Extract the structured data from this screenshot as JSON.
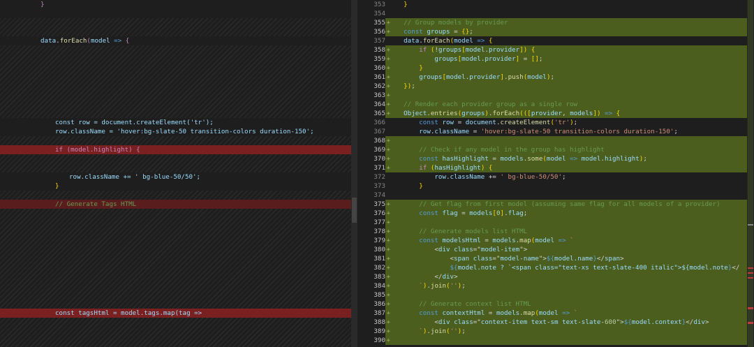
{
  "left": {
    "brace_close": "}",
    "foreach_line": [
      "data",
      ".",
      "forEach",
      "(",
      "model",
      " => ",
      "{"
    ],
    "row_create": "const row = document.createElement('tr');",
    "row_class": "row.className = 'hover:bg-slate-50 transition-colors duration-150';",
    "if_highlight": "if (model.highlight) {",
    "row_class_add": "row.className += ' bg-blue-50/50';",
    "close_brace": "}",
    "comment_tags": "// Generate Tags HTML",
    "tags_html": "const tagsHtml = model.tags.map(tag =>"
  },
  "right": {
    "lines": [
      {
        "n": "353",
        "plus": false,
        "text": "    }"
      },
      {
        "n": "354",
        "plus": false,
        "text": ""
      },
      {
        "n": "355",
        "plus": true,
        "text": "    // Group models by provider"
      },
      {
        "n": "356",
        "plus": true,
        "text": "    const groups = {};"
      },
      {
        "n": "357",
        "plus": false,
        "text": "    data.forEach(model => {"
      },
      {
        "n": "358",
        "plus": true,
        "text": "        if (!groups[model.provider]) {"
      },
      {
        "n": "359",
        "plus": true,
        "text": "            groups[model.provider] = [];"
      },
      {
        "n": "360",
        "plus": true,
        "text": "        }"
      },
      {
        "n": "361",
        "plus": true,
        "text": "        groups[model.provider].push(model);"
      },
      {
        "n": "362",
        "plus": true,
        "text": "    });"
      },
      {
        "n": "363",
        "plus": true,
        "text": ""
      },
      {
        "n": "364",
        "plus": true,
        "text": "    // Render each provider group as a single row"
      },
      {
        "n": "365",
        "plus": true,
        "text": "    Object.entries(groups).forEach(([provider, models]) => {"
      },
      {
        "n": "366",
        "plus": false,
        "text": "        const row = document.createElement('tr');"
      },
      {
        "n": "367",
        "plus": false,
        "text": "        row.className = 'hover:bg-slate-50 transition-colors duration-150';"
      },
      {
        "n": "368",
        "plus": true,
        "text": ""
      },
      {
        "n": "369",
        "plus": true,
        "text": "        // Check if any model in the group has highlight"
      },
      {
        "n": "370",
        "plus": true,
        "text": "        const hasHighlight = models.some(model => model.highlight);"
      },
      {
        "n": "371",
        "plus": true,
        "text": "        if (hasHighlight) {"
      },
      {
        "n": "372",
        "plus": false,
        "text": "            row.className += ' bg-blue-50/50';"
      },
      {
        "n": "373",
        "plus": false,
        "text": "        }"
      },
      {
        "n": "374",
        "plus": false,
        "text": ""
      },
      {
        "n": "375",
        "plus": true,
        "text": "        // Get flag from first model (assuming same flag for all models of a provider)"
      },
      {
        "n": "376",
        "plus": true,
        "text": "        const flag = models[0].flag;"
      },
      {
        "n": "377",
        "plus": true,
        "text": ""
      },
      {
        "n": "378",
        "plus": true,
        "text": "        // Generate models list HTML"
      },
      {
        "n": "379",
        "plus": true,
        "text": "        const modelsHtml = models.map(model => `"
      },
      {
        "n": "380",
        "plus": true,
        "text": "            <div class=\"model-item\">"
      },
      {
        "n": "381",
        "plus": true,
        "text": "                <span class=\"model-name\">${model.name}</span>"
      },
      {
        "n": "382",
        "plus": true,
        "text": "                ${model.note ? `<span class=\"text-xs text-slate-400 italic\">${model.note}</"
      },
      {
        "n": "383",
        "plus": true,
        "text": "            </div>"
      },
      {
        "n": "384",
        "plus": true,
        "text": "        `).join('');"
      },
      {
        "n": "385",
        "plus": true,
        "text": ""
      },
      {
        "n": "386",
        "plus": true,
        "text": "        // Generate context list HTML"
      },
      {
        "n": "387",
        "plus": true,
        "text": "        const contextHtml = models.map(model => `"
      },
      {
        "n": "388",
        "plus": true,
        "text": "            <div class=\"context-item text-sm text-slate-600\">${model.context}</div>"
      },
      {
        "n": "389",
        "plus": true,
        "text": "        `).join('');"
      },
      {
        "n": "390",
        "plus": true,
        "text": ""
      }
    ]
  },
  "colors": {
    "added_bg": "#4b5e1e",
    "deleted_bg": "#5a1d1d",
    "editor_bg": "#1e1e1e"
  }
}
